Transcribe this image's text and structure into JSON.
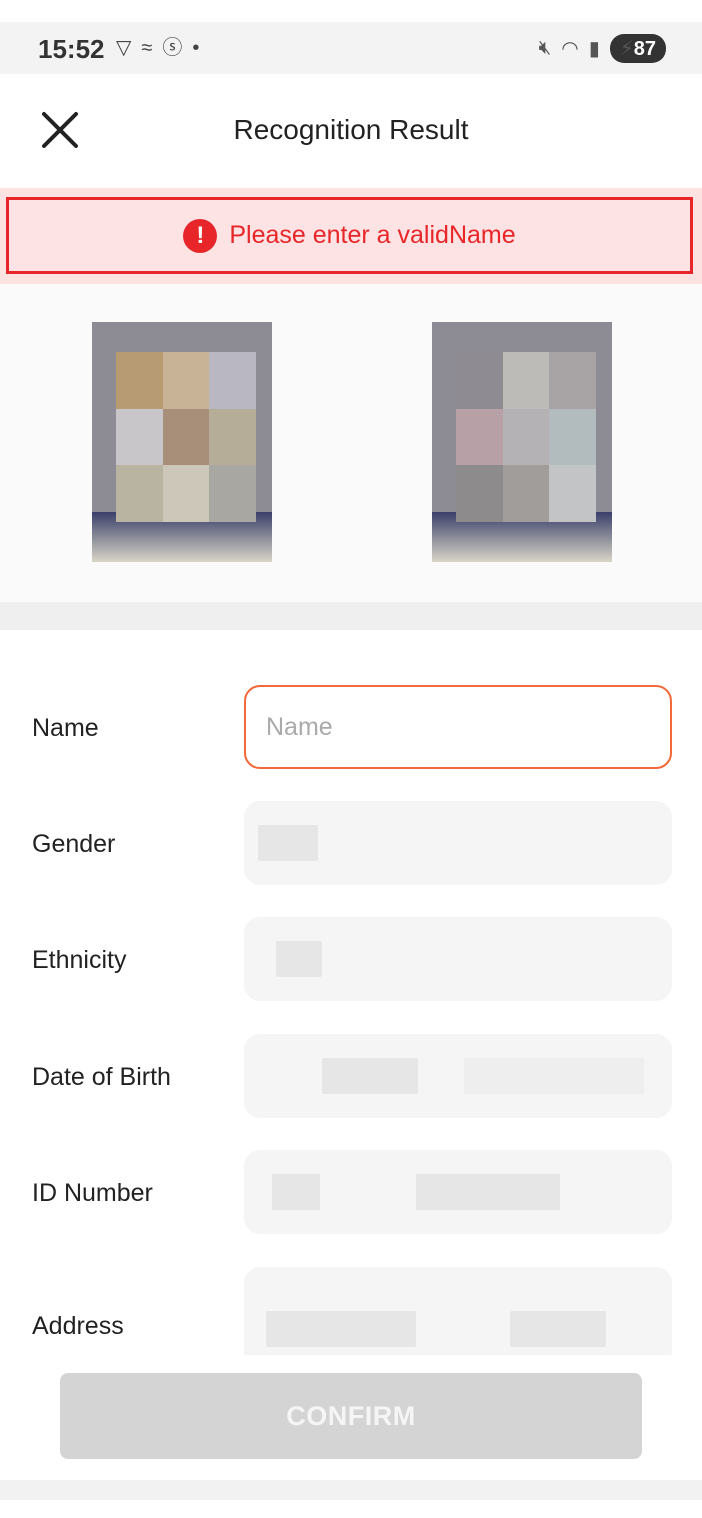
{
  "status_bar": {
    "time": "15:52",
    "battery": "87",
    "icons": [
      "vpn-icon",
      "signal-wave-icon",
      "sim-icon",
      "dot-icon",
      "mute-icon",
      "wifi-icon",
      "cell-signal-icon",
      "battery-icon"
    ]
  },
  "header": {
    "title": "Recognition Result",
    "close_icon": "close-icon"
  },
  "error": {
    "message": "Please enter a validName",
    "icon": "alert-icon",
    "color": "#e8262a"
  },
  "form": {
    "fields": [
      {
        "label": "Name",
        "placeholder": "Name",
        "value": ""
      },
      {
        "label": "Gender"
      },
      {
        "label": "Ethnicity"
      },
      {
        "label": "Date of Birth"
      },
      {
        "label": "ID Number"
      },
      {
        "label": "Address"
      }
    ]
  },
  "footer": {
    "confirm_label": "CONFIRM"
  }
}
